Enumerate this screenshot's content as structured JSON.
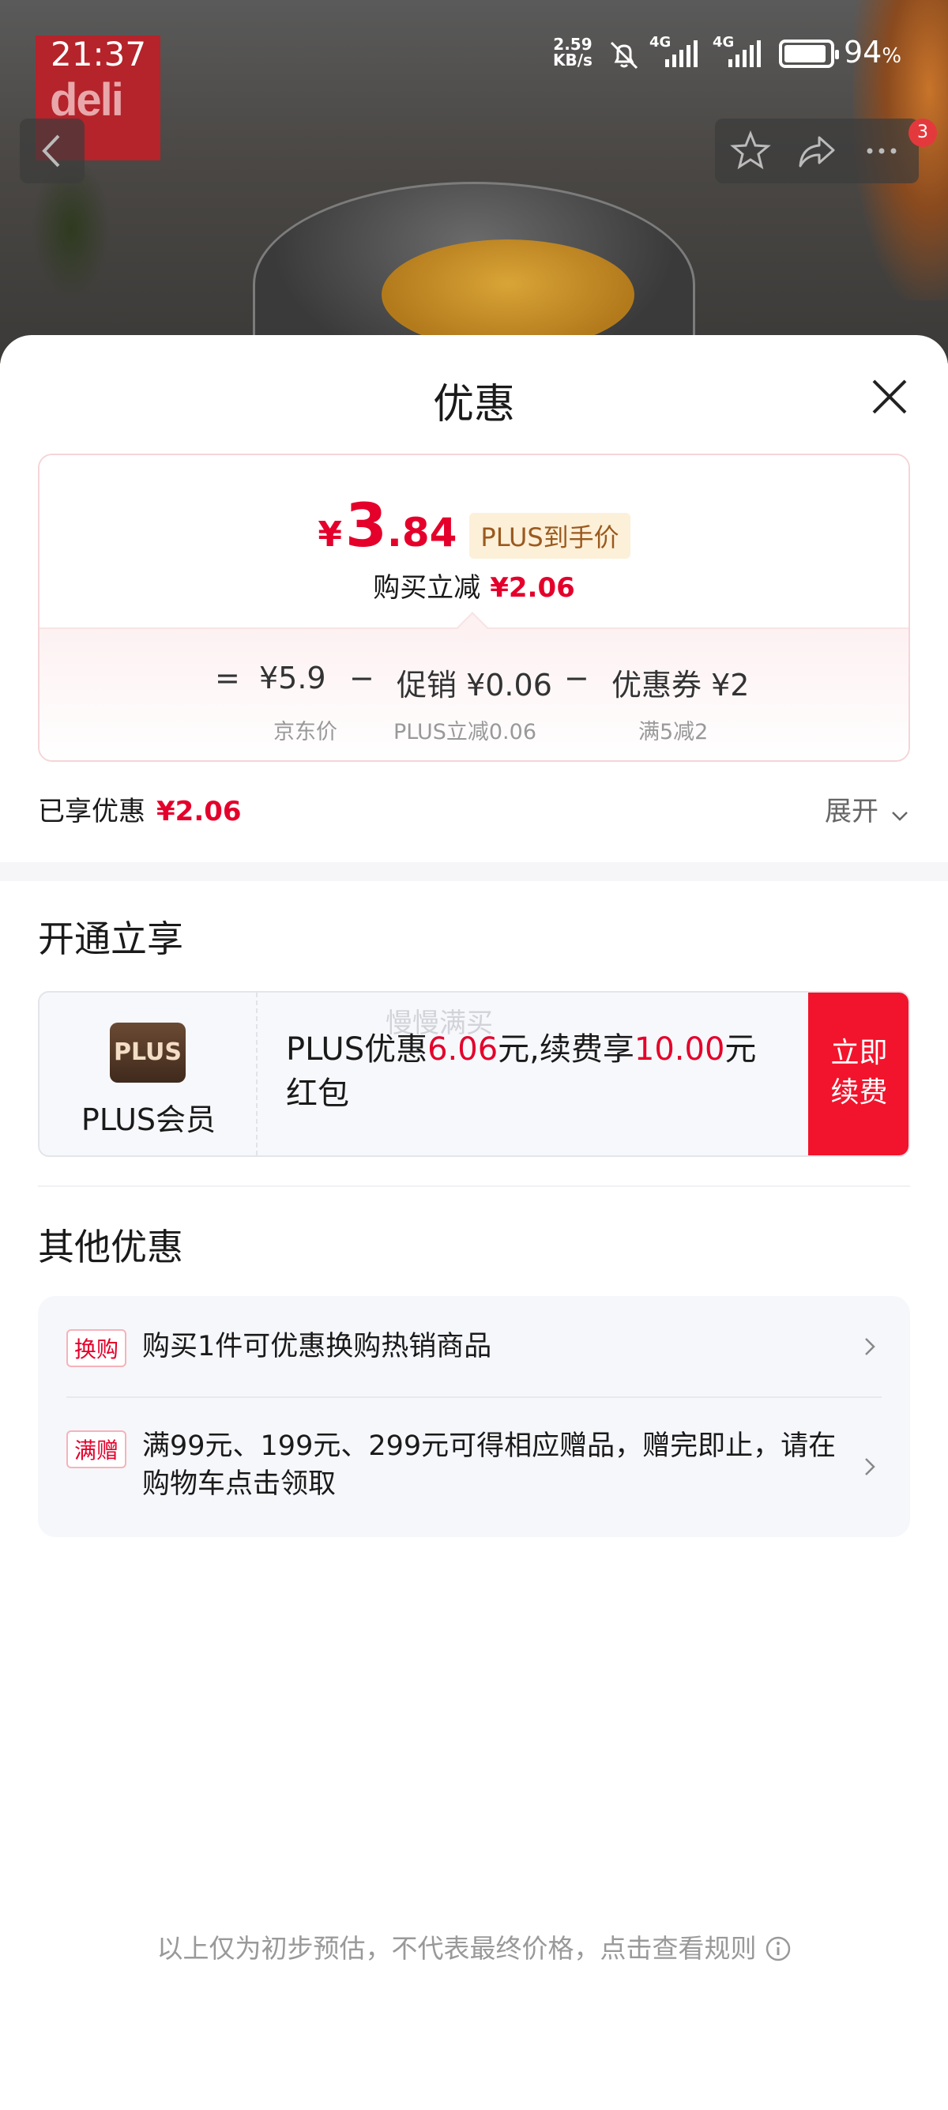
{
  "status_bar": {
    "time": "21:37",
    "net_speed_value": "2.59",
    "net_speed_unit": "KB/s",
    "sig1": "4G",
    "sig2": "4G",
    "battery_pct": "94",
    "battery_unit": "%",
    "battery_level": 0.94
  },
  "background": {
    "brand_logo": "deli"
  },
  "nav": {
    "back_icon": "chevron-left-icon",
    "notification_count": "3"
  },
  "sheet": {
    "title": "优惠",
    "summary": {
      "currency": "¥",
      "price_int": "3",
      "price_dec": ".84",
      "plus_tag": "PLUS到手价",
      "reduce_label": "购买立减",
      "reduce_value": "¥2.06",
      "eq": "=",
      "jd_price": "¥5.9",
      "jd_price_label": "京东价",
      "minus1": "−",
      "promo": "促销 ¥0.06",
      "promo_label": "PLUS立减0.06",
      "minus2": "−",
      "coupon": "优惠券 ¥2",
      "coupon_label": "满5减2"
    },
    "enjoyed_label": "已享优惠",
    "enjoyed_value": "¥2.06",
    "expand_label": "展开"
  },
  "open_section": {
    "title": "开通立享",
    "plus_logo": "PLUS",
    "plus_member": "PLUS会员",
    "offer_a": "PLUS优惠",
    "offer_b": "6.06",
    "offer_c": "元,续费享",
    "offer_d": "10.00",
    "offer_e": "元红包",
    "renew_line1": "立即",
    "renew_line2": "续费",
    "watermark": "慢慢满买"
  },
  "other_section": {
    "title": "其他优惠",
    "items": [
      {
        "tag": "换购",
        "text": "购买1件可优惠换购热销商品"
      },
      {
        "tag": "满赠",
        "text": "满99元、199元、299元可得相应赠品，赠完即止，请在购物车点击领取"
      }
    ]
  },
  "footnote": "以上仅为初步预估，不代表最终价格，点击查看规则",
  "colors": {
    "accent_red": "#e4002b",
    "button_red": "#f2142c",
    "plus_gold": "#9a5a1f"
  }
}
